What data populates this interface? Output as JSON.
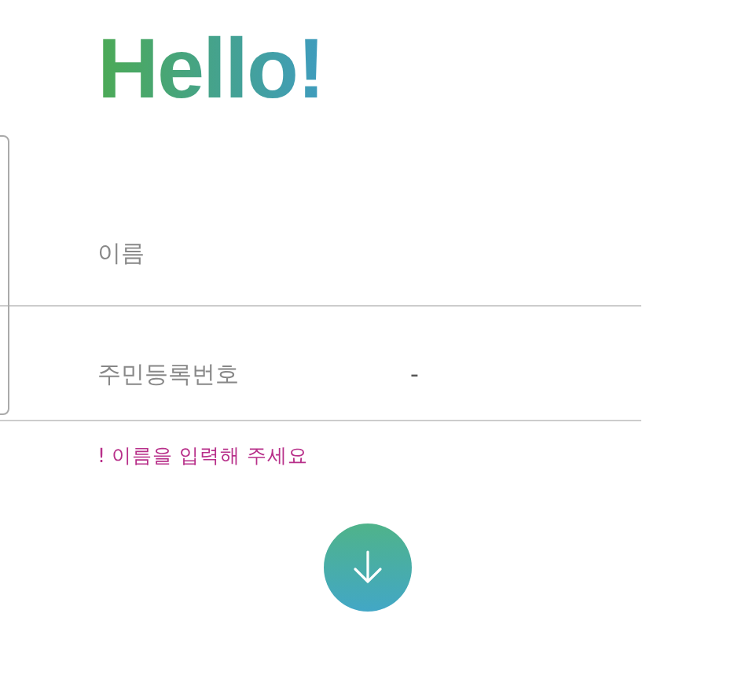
{
  "title": "Hello!",
  "fields": [
    {
      "kind": "text",
      "label": "이름"
    },
    {
      "kind": "split",
      "label": "주민등록번호",
      "separator": "-"
    }
  ],
  "error": "! 이름을 입력해 주세요"
}
